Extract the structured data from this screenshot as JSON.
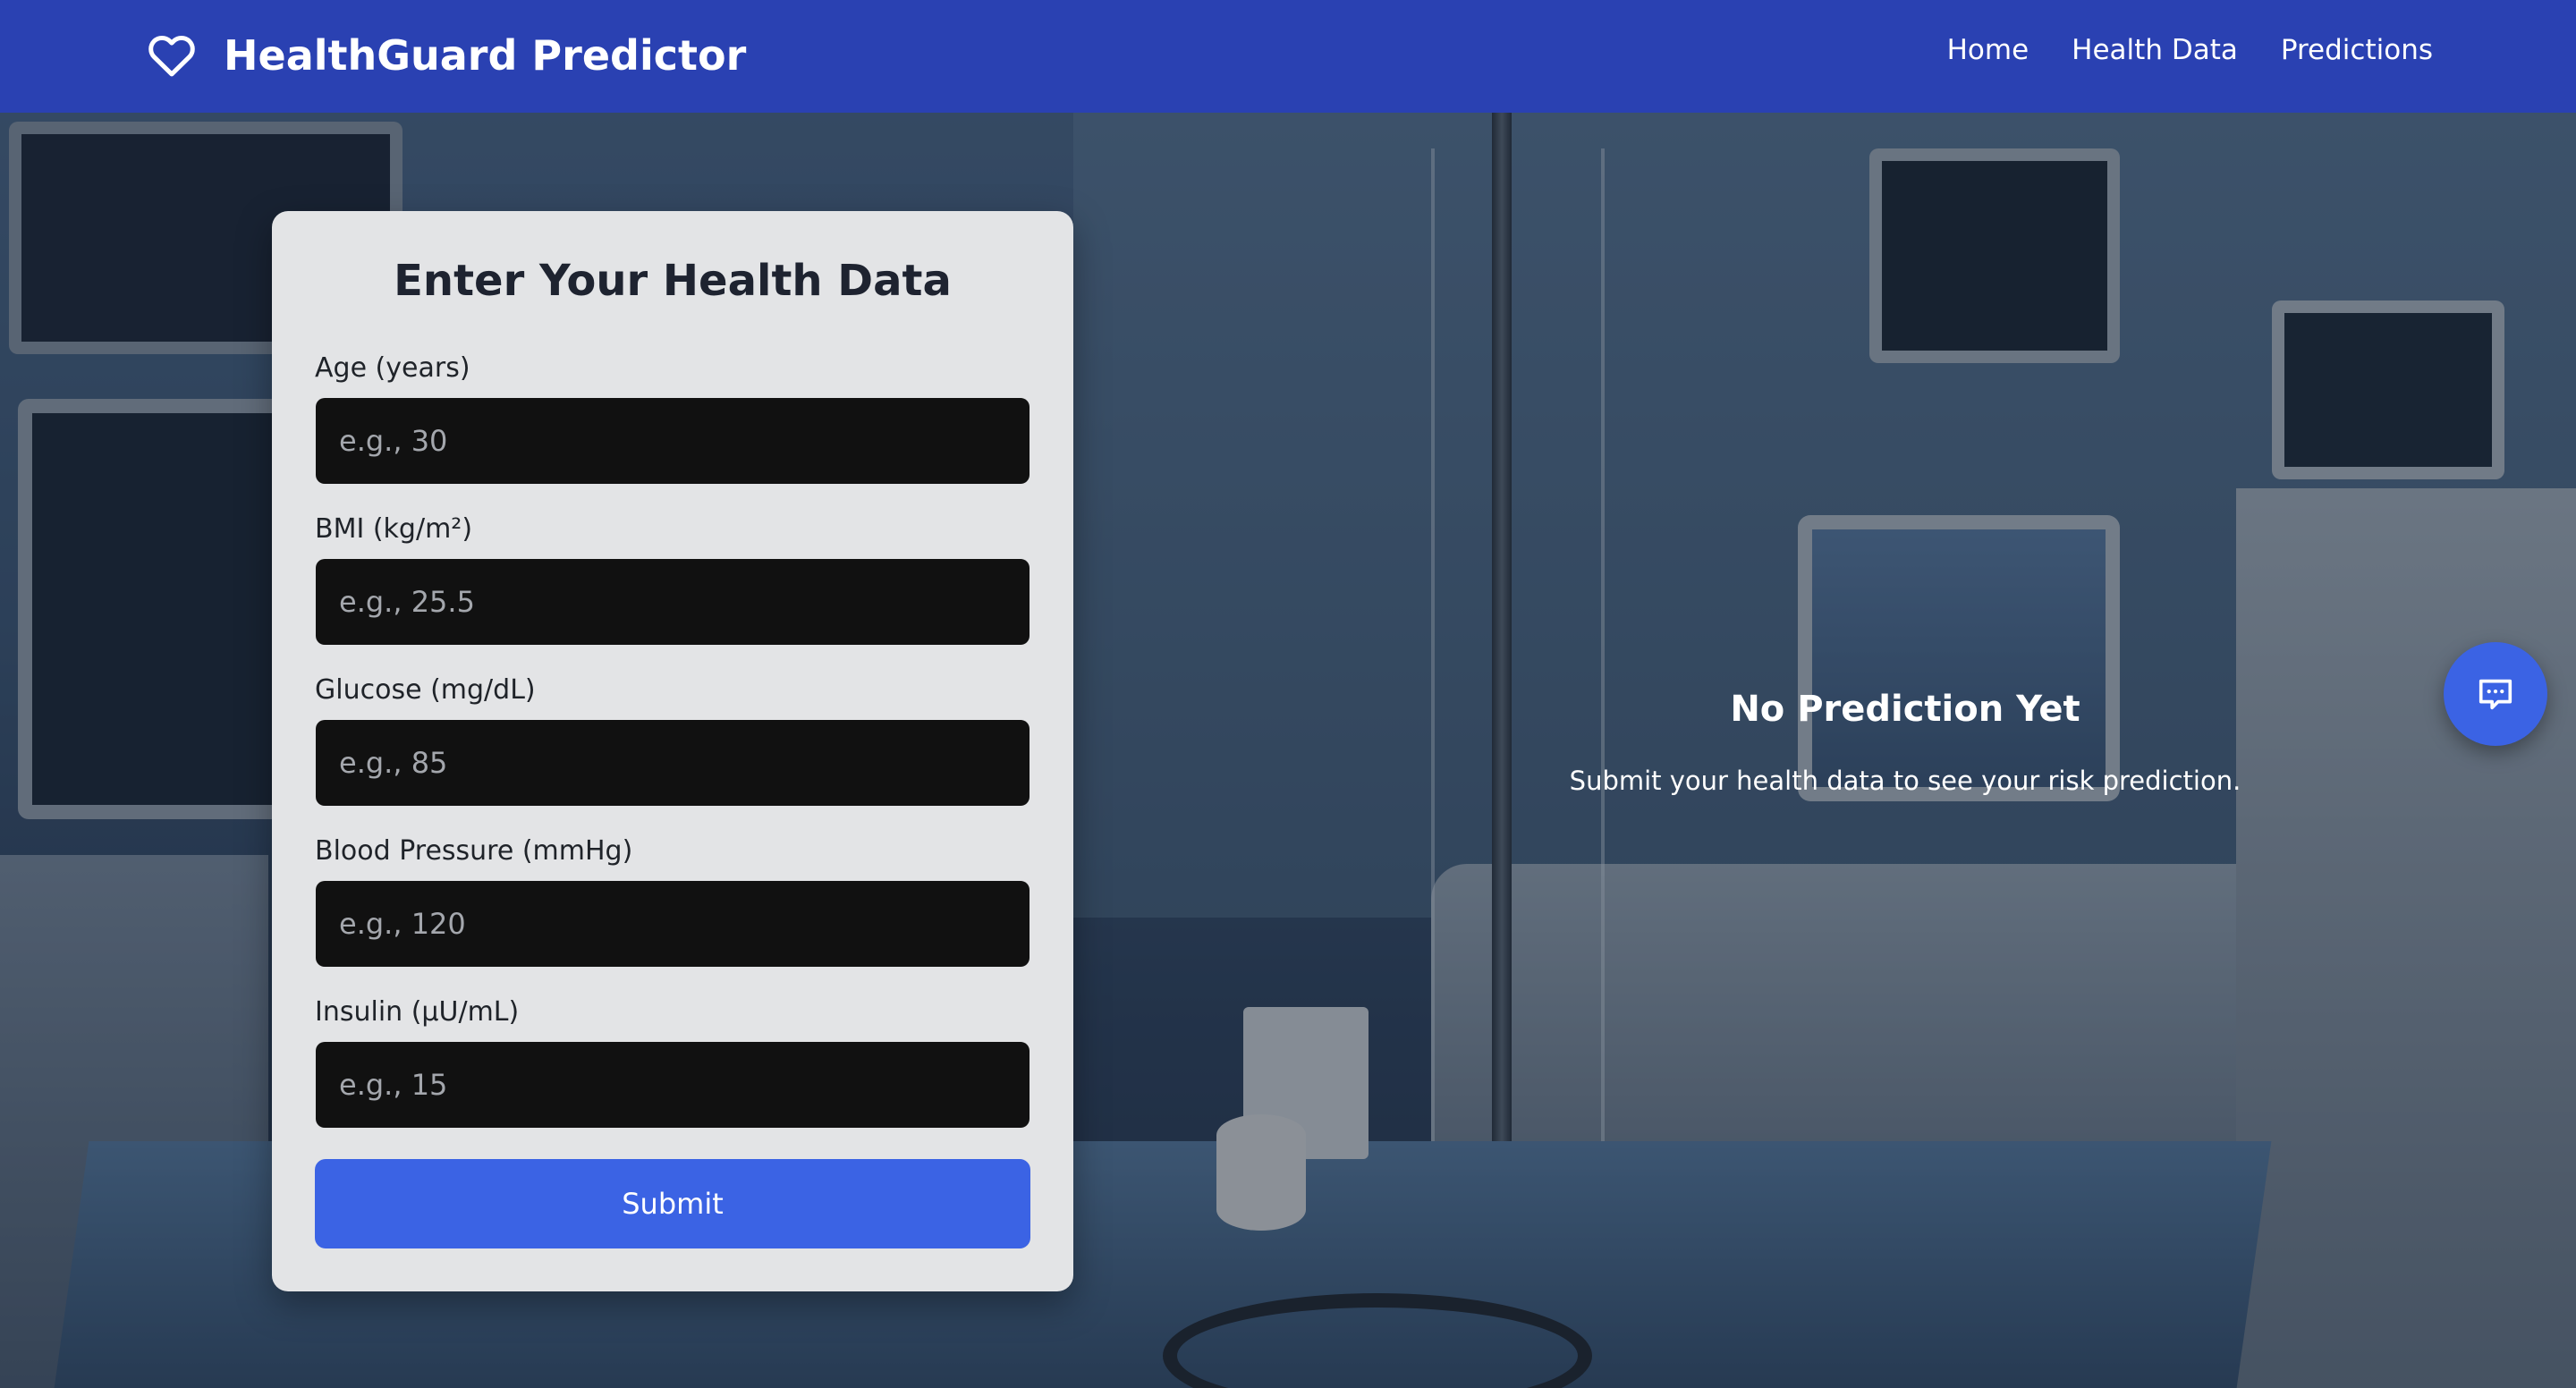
{
  "brand": {
    "title": "HealthGuard Predictor",
    "icon": "heart-icon"
  },
  "nav": {
    "items": [
      {
        "label": "Home"
      },
      {
        "label": "Health Data"
      },
      {
        "label": "Predictions"
      }
    ]
  },
  "form": {
    "heading": "Enter Your Health Data",
    "fields": [
      {
        "label": "Age (years)",
        "placeholder": "e.g., 30",
        "value": ""
      },
      {
        "label": "BMI (kg/m²)",
        "placeholder": "e.g., 25.5",
        "value": ""
      },
      {
        "label": "Glucose (mg/dL)",
        "placeholder": "e.g., 85",
        "value": ""
      },
      {
        "label": "Blood Pressure (mmHg)",
        "placeholder": "e.g., 120",
        "value": ""
      },
      {
        "label": "Insulin (µU/mL)",
        "placeholder": "e.g., 15",
        "value": ""
      }
    ],
    "submit_label": "Submit"
  },
  "prediction": {
    "title": "No Prediction Yet",
    "message": "Submit your health data to see your risk prediction."
  },
  "chat": {
    "icon": "chat-bubble-icon"
  },
  "colors": {
    "navbar": "#2a41b2",
    "accent": "#3b63e4",
    "card": "#e3e4e6",
    "input": "#111111"
  }
}
